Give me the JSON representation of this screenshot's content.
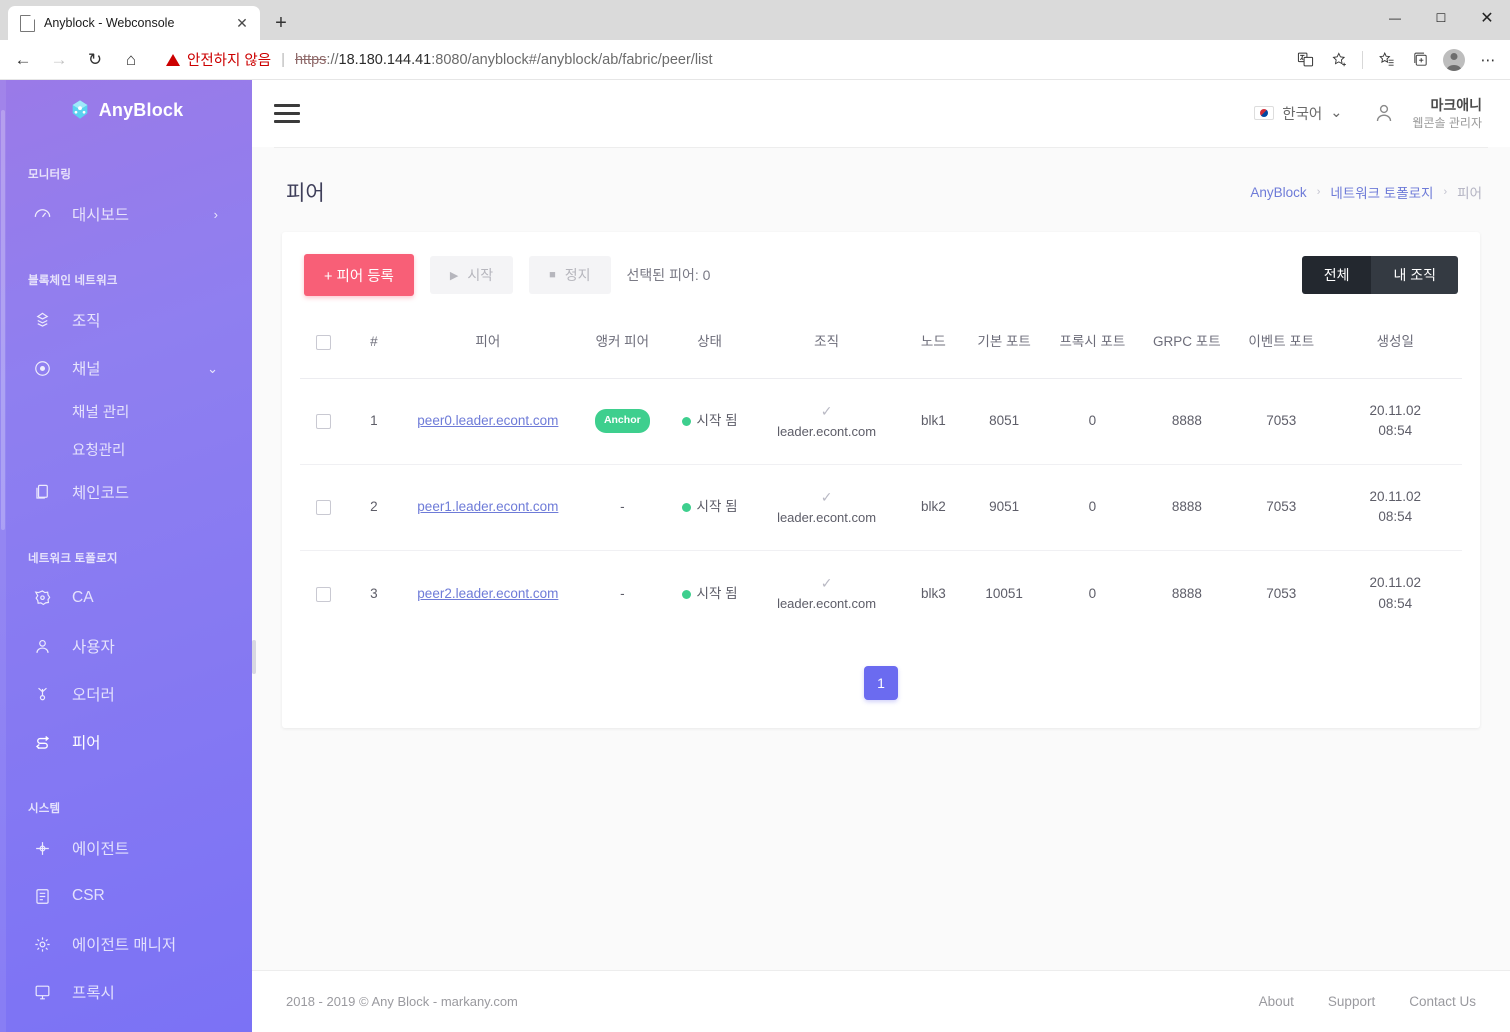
{
  "browser": {
    "tab_title": "Anyblock - Webconsole",
    "tab_close_glyph": "✕",
    "new_tab_glyph": "+",
    "back_glyph": "←",
    "forward_glyph": "→",
    "reload_glyph": "↻",
    "home_glyph": "⌂",
    "security_warning": "안전하지 않음",
    "url_scheme": "https",
    "url_sep": "://",
    "url_host": "18.180.144.41",
    "url_rest": ":8080/anyblock#/anyblock/ab/fabric/peer/list",
    "minimize_glyph": "—",
    "maximize_glyph": "☐",
    "close_glyph": "✕"
  },
  "sidebar": {
    "brand": "AnyBlock",
    "sections": [
      {
        "label": "모니터링"
      },
      {
        "label": "블록체인 네트워크"
      },
      {
        "label": "네트워크 토폴로지"
      },
      {
        "label": "시스템"
      }
    ],
    "items": [
      {
        "label": "대시보드",
        "icon": "chart-icon",
        "chevron": "›",
        "active": false
      },
      {
        "label": "조직",
        "icon": "organization-icon",
        "active": false
      },
      {
        "label": "채널",
        "icon": "channel-icon",
        "chevron": "⌄",
        "active": false
      },
      {
        "label": "채널 관리",
        "sub": true
      },
      {
        "label": "요청관리",
        "sub": true
      },
      {
        "label": "체인코드",
        "icon": "chaincode-icon",
        "active": false
      },
      {
        "label": "CA",
        "icon": "ca-icon",
        "active": false
      },
      {
        "label": "사용자",
        "icon": "user-icon",
        "active": false
      },
      {
        "label": "오더러",
        "icon": "orderer-icon",
        "active": false
      },
      {
        "label": "피어",
        "icon": "peer-icon",
        "active": true
      },
      {
        "label": "에이전트",
        "icon": "agent-icon",
        "active": false
      },
      {
        "label": "CSR",
        "icon": "csr-icon",
        "active": false
      },
      {
        "label": "에이전트 매니저",
        "icon": "agent-manager-icon",
        "active": false
      },
      {
        "label": "프록시",
        "icon": "proxy-icon",
        "active": false
      }
    ]
  },
  "topbar": {
    "language": "한국어",
    "language_chevron": "⌄",
    "user_name": "마크애니",
    "user_role": "웹콘솔 관리자"
  },
  "page": {
    "title": "피어",
    "breadcrumb": [
      {
        "label": "AnyBlock",
        "current": false
      },
      {
        "label": "네트워크 토폴로지",
        "current": false
      },
      {
        "label": "피어",
        "current": true
      }
    ],
    "breadcrumb_sep": "›"
  },
  "toolbar": {
    "register_label": "+ 피어 등록",
    "start_label": "시작",
    "start_glyph": "▶",
    "stop_label": "정지",
    "stop_glyph": "■",
    "selected_label": "선택된 피어: 0",
    "seg_all": "전체",
    "seg_my_org": "내 조직"
  },
  "table": {
    "headers": [
      "",
      "#",
      "피어",
      "앵커 피어",
      "상태",
      "조직",
      "노드",
      "기본 포트",
      "프록시 포트",
      "GRPC 포트",
      "이벤트 포트",
      "생성일"
    ],
    "rows": [
      {
        "num": "1",
        "peer": "peer0.leader.econt.com",
        "anchor": "Anchor",
        "anchor_is_badge": true,
        "status": "시작 됨",
        "org_check": "✓",
        "org": "leader.econt.com",
        "node": "blk1",
        "base_port": "8051",
        "proxy_port": "0",
        "grpc_port": "8888",
        "event_port": "7053",
        "created": "20.11.02\n08:54"
      },
      {
        "num": "2",
        "peer": "peer1.leader.econt.com",
        "anchor": "-",
        "anchor_is_badge": false,
        "status": "시작 됨",
        "org_check": "✓",
        "org": "leader.econt.com",
        "node": "blk2",
        "base_port": "9051",
        "proxy_port": "0",
        "grpc_port": "8888",
        "event_port": "7053",
        "created": "20.11.02\n08:54"
      },
      {
        "num": "3",
        "peer": "peer2.leader.econt.com",
        "anchor": "-",
        "anchor_is_badge": false,
        "status": "시작 됨",
        "org_check": "✓",
        "org": "leader.econt.com",
        "node": "blk3",
        "base_port": "10051",
        "proxy_port": "0",
        "grpc_port": "8888",
        "event_port": "7053",
        "created": "20.11.02\n08:54"
      }
    ],
    "pagination": {
      "current": "1"
    }
  },
  "footer": {
    "copyright": "2018 - 2019 © Any Block - markany.com",
    "links": [
      "About",
      "Support",
      "Contact Us"
    ]
  },
  "colors": {
    "sidebar_start": "#9a7ae8",
    "sidebar_end": "#7b72f5",
    "primary_button": "#f85f77",
    "link": "#6e7bd8",
    "status_green": "#3ecf8e",
    "pager": "#6b6bf0",
    "segment_dark": "#23282f"
  }
}
